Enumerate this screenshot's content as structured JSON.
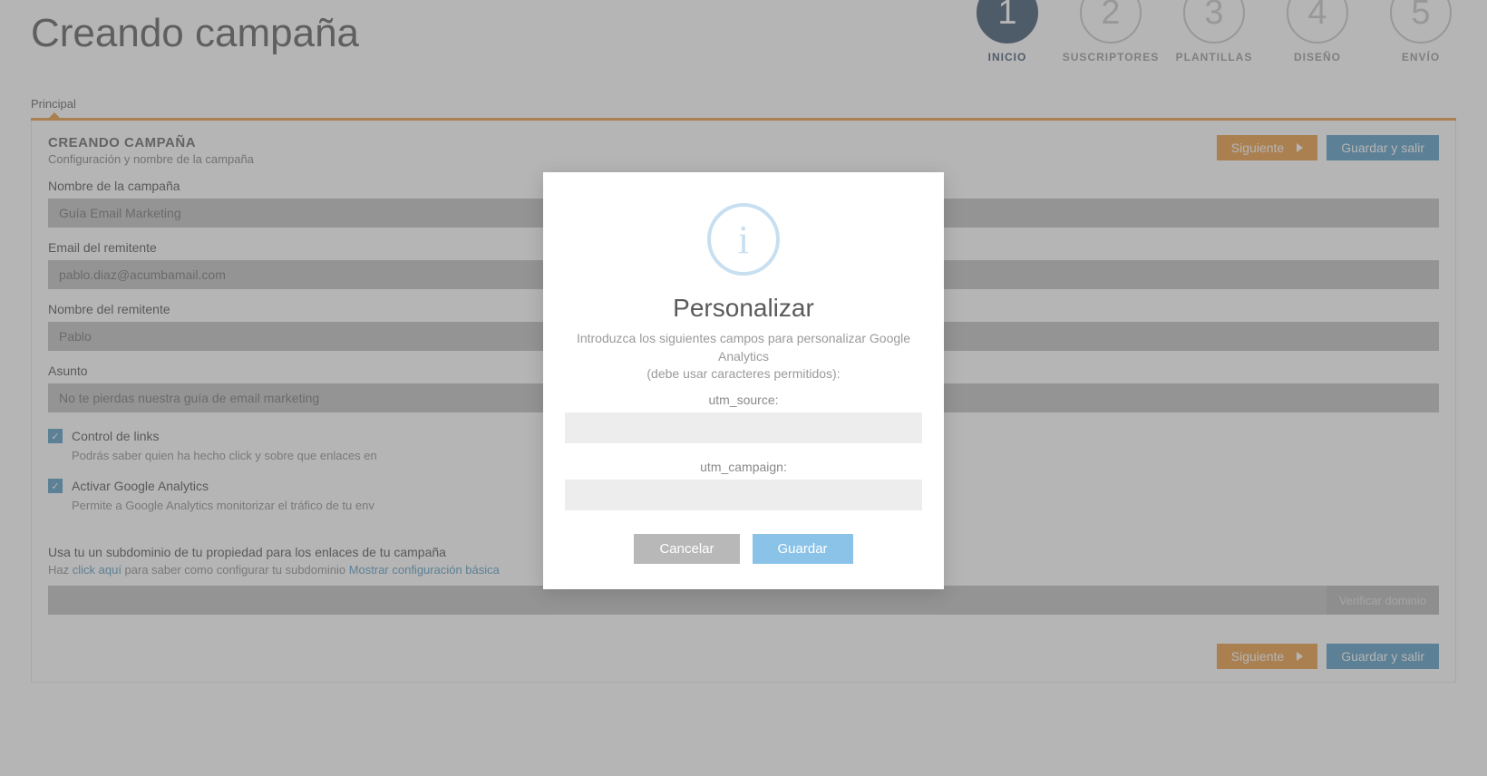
{
  "page_title": "Creando campaña",
  "steps": [
    {
      "num": "1",
      "label": "INICIO",
      "active": true
    },
    {
      "num": "2",
      "label": "SUSCRIPTORES",
      "active": false
    },
    {
      "num": "3",
      "label": "PLANTILLAS",
      "active": false
    },
    {
      "num": "4",
      "label": "DISEÑO",
      "active": false
    },
    {
      "num": "5",
      "label": "ENVÍO",
      "active": false
    }
  ],
  "tab_label": "Principal",
  "panel_header": {
    "title": "CREANDO CAMPAÑA",
    "subtitle": "Configuración y nombre de la campaña"
  },
  "buttons": {
    "next": "Siguiente",
    "save_exit": "Guardar y salir",
    "verify": "Verificar dominio"
  },
  "fields": {
    "campaign_name": {
      "label": "Nombre de la campaña",
      "value": "Guía Email Marketing"
    },
    "sender_email": {
      "label": "Email del remitente",
      "value": "pablo.diaz@acumbamail.com"
    },
    "sender_name": {
      "label": "Nombre del remitente",
      "value": "Pablo"
    },
    "subject": {
      "label": "Asunto",
      "value": "No te pierdas nuestra guía de email marketing"
    }
  },
  "checks": {
    "link_control": {
      "label": "Control de links",
      "help": "Podrás saber quien ha hecho click y sobre que enlaces en"
    },
    "ga": {
      "label": "Activar Google Analytics",
      "help": "Permite a Google Analytics monitorizar el tráfico de tu env"
    }
  },
  "subdomain": {
    "title": "Usa tu un subdominio de tu propiedad para los enlaces de tu campaña",
    "help_prefix": "Haz ",
    "help_link1": "click aquí",
    "help_mid": " para saber como configurar tu subdominio ",
    "help_link2": "Mostrar configuración básica"
  },
  "modal": {
    "title": "Personalizar",
    "desc1": "Introduzca los siguientes campos para personalizar Google Analytics",
    "desc2": "(debe usar caracteres permitidos):",
    "utm_source_label": "utm_source:",
    "utm_campaign_label": "utm_campaign:",
    "cancel": "Cancelar",
    "save": "Guardar"
  }
}
